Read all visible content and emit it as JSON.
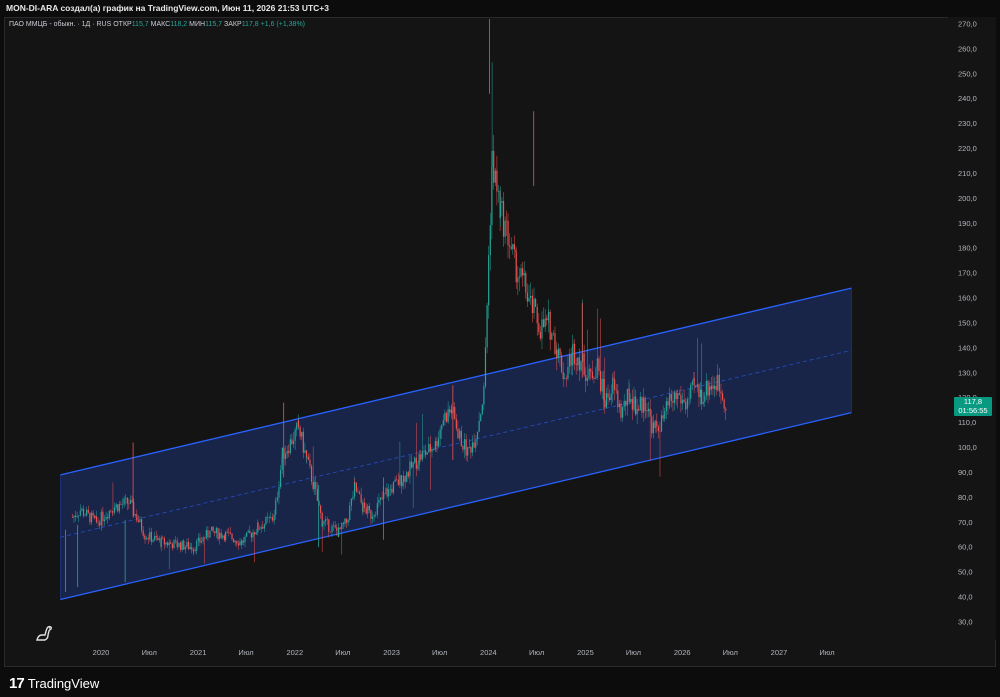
{
  "header": {
    "title": "MON-DI-ARA создал(а) график на TradingView.com, Июн 11, 2026 21:53 UTC+3"
  },
  "legend": {
    "symbol": "ПАО ММЦБ - обыкн. · 1Д · RUS",
    "open_label": "ОТКР",
    "open_value": "115,7",
    "high_label": "МАКС",
    "high_value": "118,2",
    "low_label": "МИН",
    "low_value": "115,7",
    "close_label": "ЗАКР",
    "close_value": "117,8",
    "change": "+1,6 (+1,38%)"
  },
  "price_tag": {
    "price": "117,8",
    "countdown": "01:56:55"
  },
  "footer": {
    "brand": "TradingView"
  },
  "colors": {
    "background": "#141414",
    "channel_line": "#2962ff",
    "channel_fill": "#1a2a5a",
    "up": "#26a69a",
    "down": "#ef5350",
    "tag": "#089981"
  },
  "chart_data": {
    "type": "candlestick",
    "y_axis": {
      "ticks": [
        "270,0",
        "260,0",
        "250,0",
        "240,0",
        "230,0",
        "220,0",
        "210,0",
        "200,0",
        "190,0",
        "180,0",
        "170,0",
        "160,0",
        "150,0",
        "140,0",
        "130,0",
        "120,0",
        "110,0",
        "100,0",
        "90,0",
        "80,0",
        "70,0",
        "60,0",
        "50,0",
        "40,0",
        "30,0"
      ],
      "range": [
        25,
        275
      ]
    },
    "x_axis": {
      "ticks": [
        "2020",
        "Июл",
        "2021",
        "Июл",
        "2022",
        "Июл",
        "2023",
        "Июл",
        "2024",
        "Июл",
        "2025",
        "Июл",
        "2026",
        "Июл",
        "2027",
        "Июл"
      ]
    },
    "channel": {
      "upper": [
        {
          "date": "2019-08-01",
          "value": 89
        },
        {
          "date": "2027-10-01",
          "value": 164
        }
      ],
      "middle": [
        {
          "date": "2019-08-01",
          "value": 64
        },
        {
          "date": "2027-10-01",
          "value": 139
        }
      ],
      "lower": [
        {
          "date": "2019-08-01",
          "value": 39
        },
        {
          "date": "2027-10-01",
          "value": 114
        }
      ]
    },
    "price_path": [
      [
        "2019-09",
        72
      ],
      [
        "2019-10",
        75
      ],
      [
        "2019-12",
        70
      ],
      [
        "2020-02",
        76
      ],
      [
        "2020-04",
        78
      ],
      [
        "2020-05",
        72
      ],
      [
        "2020-06",
        65
      ],
      [
        "2020-08",
        62
      ],
      [
        "2020-10",
        61
      ],
      [
        "2020-12",
        60
      ],
      [
        "2021-02",
        66
      ],
      [
        "2021-04",
        65
      ],
      [
        "2021-06",
        62
      ],
      [
        "2021-08",
        68
      ],
      [
        "2021-10",
        72
      ],
      [
        "2021-11",
        97
      ],
      [
        "2021-12",
        102
      ],
      [
        "2022-01",
        108
      ],
      [
        "2022-02",
        95
      ],
      [
        "2022-03",
        84
      ],
      [
        "2022-04",
        70
      ],
      [
        "2022-06",
        66
      ],
      [
        "2022-07",
        70
      ],
      [
        "2022-08",
        84
      ],
      [
        "2022-09",
        76
      ],
      [
        "2022-10",
        73
      ],
      [
        "2022-12",
        82
      ],
      [
        "2023-02",
        88
      ],
      [
        "2023-04",
        96
      ],
      [
        "2023-06",
        101
      ],
      [
        "2023-07",
        112
      ],
      [
        "2023-08",
        115
      ],
      [
        "2023-09",
        104
      ],
      [
        "2023-10",
        98
      ],
      [
        "2023-11",
        105
      ],
      [
        "2023-12",
        122
      ],
      [
        "2024-01",
        215
      ],
      [
        "2024-02",
        195
      ],
      [
        "2024-03",
        185
      ],
      [
        "2024-04",
        172
      ],
      [
        "2024-05",
        165
      ],
      [
        "2024-06",
        156
      ],
      [
        "2024-07",
        148
      ],
      [
        "2024-08",
        150
      ],
      [
        "2024-09",
        140
      ],
      [
        "2024-10",
        128
      ],
      [
        "2024-11",
        139
      ],
      [
        "2024-12",
        135
      ],
      [
        "2025-01",
        128
      ],
      [
        "2025-02",
        133
      ],
      [
        "2025-03",
        118
      ],
      [
        "2025-04",
        125
      ],
      [
        "2025-05",
        114
      ],
      [
        "2025-06",
        121
      ],
      [
        "2025-07",
        116
      ],
      [
        "2025-08",
        118
      ],
      [
        "2025-09",
        107
      ],
      [
        "2025-10",
        110
      ],
      [
        "2025-11",
        118
      ],
      [
        "2025-12",
        121
      ],
      [
        "2026-01",
        117
      ],
      [
        "2026-02",
        124
      ],
      [
        "2026-03",
        121
      ],
      [
        "2026-04",
        125
      ],
      [
        "2026-05",
        126
      ],
      [
        "2026-06",
        117.8
      ]
    ],
    "last_close": 117.8
  }
}
